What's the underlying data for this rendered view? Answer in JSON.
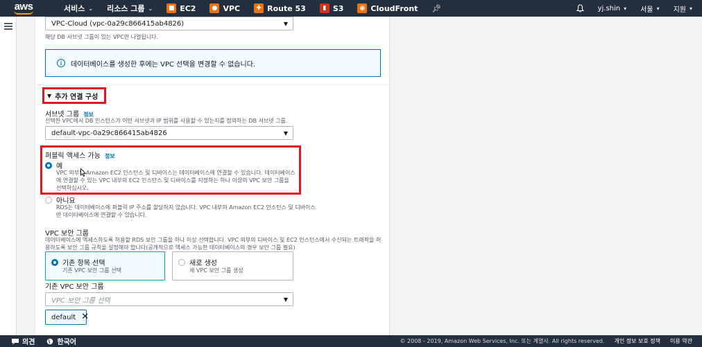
{
  "nav": {
    "logo": "aws",
    "services": "서비스",
    "resource_groups": "리소스 그룹",
    "shortcuts": [
      {
        "label": "EC2",
        "icon": "ec2-icon",
        "color": "#ec7211"
      },
      {
        "label": "VPC",
        "icon": "vpc-icon",
        "color": "#ec7211"
      },
      {
        "label": "Route 53",
        "icon": "route53-icon",
        "color": "#ec7211"
      },
      {
        "label": "S3",
        "icon": "s3-icon",
        "color": "#d13212"
      },
      {
        "label": "CloudFront",
        "icon": "cloudfront-icon",
        "color": "#ec7211"
      }
    ],
    "user": "yj.shin",
    "region": "서울",
    "support": "지원"
  },
  "form": {
    "vpc_select_value": "VPC-Cloud (vpc-0a29c866415ab4826)",
    "vpc_hint": "해당 DB 서브넷 그룹이 있는 VPC만 나열됩니다.",
    "alert_text": "데이터베이스를 생성한 후에는 VPC 선택을 변경할 수 없습니다.",
    "additional_section": "추가 연결 구성",
    "subnet_label": "서브넷 그룹",
    "info": "정보",
    "subnet_hint": "선택한 VPC에서 DB 인스턴스가 어떤 서브넷과 IP 범위를 사용할 수 있는지를 정의하는 DB 서브넷 그룹.",
    "subnet_value": "default-vpc-0a29c866415ab4826",
    "public_label": "퍼블릭 액세스 가능",
    "yes_label": "예",
    "yes_desc": "VPC 외부의 Amazon EC2 인스턴스 및 디바이스는 데이터베이스에 연결할 수 있습니다. 데이터베이스에 연결할 수 있는 VPC 내부의 EC2 인스턴스 및 디바이스를 지정하는 하나 이상의 VPC 보안 그룹을 선택하십시오.",
    "no_label": "아니요",
    "no_desc": "RDS는 데이터베이스에 퍼블릭 IP 주소를 할당하지 않습니다. VPC 내부의 Amazon EC2 인스턴스 및 디바이스만 데이터베이스에 연결할 수 있습니다.",
    "sg_label": "VPC 보안 그룹",
    "sg_hint": "데이터베이스에 액세스하도록 허용할 RDS 보안 그룹을 하나 이상 선택합니다. VPC 외부의 디바이스 및 EC2 인스턴스에서 수신되는 트래픽을 허용하도록 보안 그룹 규칙을 설정해야 합니다(공개적으로 액세스 가능한 데이터베이스의 경우 보안 그룹 필요)",
    "existing_title": "기존 항목 선택",
    "existing_sub": "기존 VPC 보안 그룹 선택",
    "new_title": "새로 생성",
    "new_sub": "새 VPC 보안 그룹 생성",
    "existing_sg_label": "기존 VPC 보안 그룹",
    "existing_sg_placeholder": "VPC 보안 그룹 선택",
    "token": "default"
  },
  "footer": {
    "feedback": "의견",
    "language": "한국어",
    "copyright": "© 2008 - 2019, Amazon Web Services, Inc. 또는 계열사. All rights reserved.",
    "privacy": "개인 정보 보호 정책",
    "terms": "이용 약관"
  }
}
